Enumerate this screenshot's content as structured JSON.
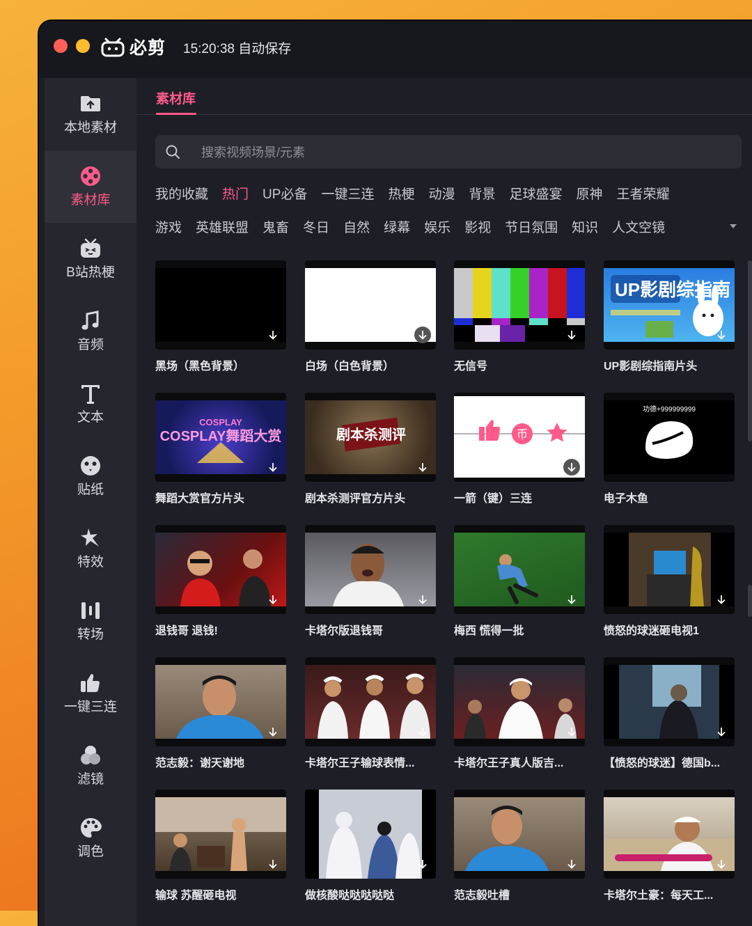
{
  "app": {
    "logo_text": "必剪",
    "save_status": "15:20:38 自动保存",
    "window_controls": [
      "close",
      "minimize"
    ]
  },
  "sidebar": {
    "items": [
      {
        "label": "本地素材",
        "icon": "folder-upload-icon"
      },
      {
        "label": "素材库",
        "icon": "film-reel-icon",
        "active": true
      },
      {
        "label": "B站热梗",
        "icon": "bilibili-tv-icon"
      },
      {
        "label": "音频",
        "icon": "music-note-icon"
      },
      {
        "label": "文本",
        "icon": "text-t-icon"
      },
      {
        "label": "贴纸",
        "icon": "sticker-face-icon"
      },
      {
        "label": "特效",
        "icon": "effect-star-icon"
      },
      {
        "label": "转场",
        "icon": "transition-bars-icon"
      },
      {
        "label": "一键三连",
        "icon": "thumbs-up-icon"
      },
      {
        "label": "滤镜",
        "icon": "filter-circles-icon"
      },
      {
        "label": "调色",
        "icon": "palette-icon"
      }
    ]
  },
  "tabs": {
    "active_label": "素材库"
  },
  "search": {
    "placeholder": "搜索视频场景/元素"
  },
  "categories": {
    "row1": [
      "我的收藏",
      "热门",
      "UP必备",
      "一键三连",
      "热梗",
      "动漫",
      "背景",
      "足球盛宴",
      "原神",
      "王者荣耀"
    ],
    "row2": [
      "游戏",
      "英雄联盟",
      "鬼畜",
      "冬日",
      "自然",
      "绿幕",
      "娱乐",
      "影视",
      "节日氛围",
      "知识",
      "人文空镜"
    ],
    "selected": "热门"
  },
  "grid": {
    "items": [
      {
        "title": "黑场（黑色背景）"
      },
      {
        "title": "白场（白色背景）"
      },
      {
        "title": "无信号"
      },
      {
        "title": "UP影剧综指南片头",
        "thumb_text": "UP影剧综指南"
      },
      {
        "title": "舞蹈大赏官方片头",
        "thumb_text": "COSPLAY舞蹈大赏"
      },
      {
        "title": "剧本杀测评官方片头",
        "thumb_text": "剧本杀测评"
      },
      {
        "title": "一箭（键）三连"
      },
      {
        "title": "电子木鱼",
        "thumb_text": "功德+999999999"
      },
      {
        "title": "退钱哥 退钱!"
      },
      {
        "title": "卡塔尔版退钱哥"
      },
      {
        "title": "梅西 慌得一批"
      },
      {
        "title": "愤怒的球迷砸电视1"
      },
      {
        "title": "范志毅：谢天谢地"
      },
      {
        "title": "卡塔尔王子输球表情..."
      },
      {
        "title": "卡塔尔王子真人版吉..."
      },
      {
        "title": "【愤怒的球迷】德国b..."
      },
      {
        "title": "输球 苏醒砸电视"
      },
      {
        "title": "做核酸哒哒哒哒哒"
      },
      {
        "title": "范志毅吐槽"
      },
      {
        "title": "卡塔尔土豪：每天工..."
      }
    ]
  },
  "colors": {
    "accent": "#ff5a8a",
    "window_bg": "#1e1f26",
    "sidebar_bg": "#26272e"
  }
}
